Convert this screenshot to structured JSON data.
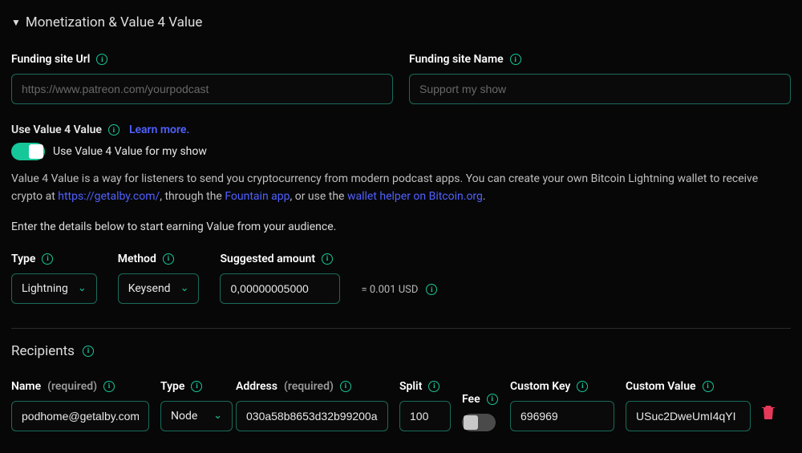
{
  "section_title": "Monetization & Value 4 Value",
  "funding_url": {
    "label": "Funding site Url",
    "placeholder": "https://www.patreon.com/yourpodcast",
    "value": ""
  },
  "funding_name": {
    "label": "Funding site Name",
    "placeholder": "Support my show",
    "value": ""
  },
  "v4v": {
    "label": "Use Value 4 Value",
    "learn_more": "Learn more.",
    "toggle_label": "Use Value 4 Value for my show",
    "desc_prefix": "Value 4 Value is a way for listeners to send you cryptocurrency from modern podcast apps. You can create your own Bitcoin Lightning wallet to receive crypto at ",
    "link1": "https://getalby.com/",
    "desc_mid1": ", through the ",
    "link2": "Fountain app",
    "desc_mid2": ", or use the ",
    "link3": "wallet helper on Bitcoin.org",
    "desc_suffix": ".",
    "desc2": "Enter the details below to start earning Value from your audience."
  },
  "type": {
    "label": "Type",
    "value": "Lightning"
  },
  "method": {
    "label": "Method",
    "value": "Keysend"
  },
  "suggested": {
    "label": "Suggested amount",
    "value": "0,00000005000"
  },
  "usd_eq": "= 0.001 USD",
  "recipients_title": "Recipients",
  "recipient_labels": {
    "name": "Name",
    "name_req": "(required)",
    "type": "Type",
    "address": "Address",
    "address_req": "(required)",
    "split": "Split",
    "fee": "Fee",
    "ckey": "Custom Key",
    "cval": "Custom Value"
  },
  "recipient": {
    "name": "podhome@getalby.com",
    "type": "Node",
    "address": "030a58b8653d32b99200a",
    "split": "100",
    "ckey": "696969",
    "cval": "USuc2DweUmI4qYI"
  }
}
